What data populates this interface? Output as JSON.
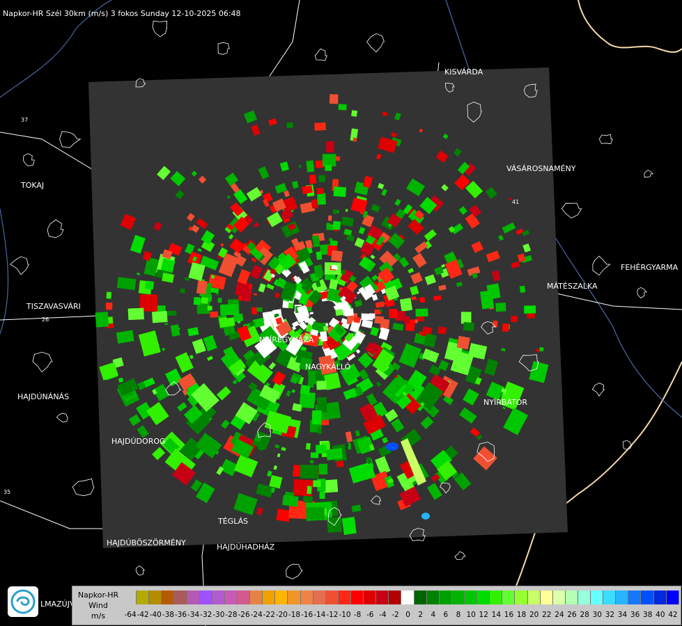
{
  "header": {
    "title": "Napkor-HR Szél 30km (m/s) 3 fokos Sunday 12-10-2025 06:48"
  },
  "map": {
    "background": "#000000",
    "radar_area_color": "#333333",
    "boundary_color": "#f5d9a8",
    "river_color": "#4a6aa8",
    "road_color": "#ffffff",
    "cities": [
      {
        "id": "kisvarda",
        "name": "KISVÁRDA"
      },
      {
        "id": "tokaj",
        "name": "TOKAJ"
      },
      {
        "id": "vasarosnameny",
        "name": "VÁSÁROSNAMÉNY"
      },
      {
        "id": "fehergyarmat",
        "name": "FEHÉRGYARMA"
      },
      {
        "id": "mateszalka",
        "name": "MÁTÉSZALKA"
      },
      {
        "id": "tiszavasvari",
        "name": "TISZAVASVÁRI"
      },
      {
        "id": "nyiregyhaza",
        "name": "NYÍREGYHÁZA"
      },
      {
        "id": "nagykallo",
        "name": "NAGYKÁLLÓ"
      },
      {
        "id": "hajdunanas",
        "name": "HAJDÚNÁNÁS"
      },
      {
        "id": "nyirbator",
        "name": "NYÍRBÁTOR"
      },
      {
        "id": "hajdudorog",
        "name": "HAJDÚDOROG"
      },
      {
        "id": "teglas",
        "name": "TÉGLÁS"
      },
      {
        "id": "hajduboszormeny",
        "name": "HAJDÚBÖSZÖRMÉNY"
      },
      {
        "id": "hajduhadhaz",
        "name": "HAJDÚHADHÁZ"
      }
    ],
    "road_numbers": [
      "37",
      "26",
      "41",
      "35"
    ],
    "partial_label": "LMAZÚJVÁR"
  },
  "legend": {
    "line1": "Napkor-HR",
    "line2": "Wind",
    "line3": "m/s",
    "colors": [
      "#c8c8c8",
      "#b4aa00",
      "#b48c00",
      "#b45a00",
      "#aa5a5a",
      "#b45ab4",
      "#a050ff",
      "#b45ad2",
      "#c85ab4",
      "#d25a8c",
      "#e68246",
      "#f0a000",
      "#ffb400",
      "#f09628",
      "#f08246",
      "#e66e50",
      "#f05032",
      "#ff2814",
      "#ff0000",
      "#dc0000",
      "#c80014",
      "#b40000",
      "#ffffff",
      "#006400",
      "#008200",
      "#00a000",
      "#00b400",
      "#00c800",
      "#00dc00",
      "#32f000",
      "#64ff32",
      "#96ff32",
      "#c8ff64",
      "#ffff96",
      "#dcffaa",
      "#b4ffb4",
      "#96ffdc",
      "#64ffff",
      "#3cdcff",
      "#28b4ff",
      "#1478ff",
      "#0050ff",
      "#0028dc",
      "#0000ff"
    ],
    "ticks": [
      "-64",
      "-42",
      "-40",
      "-38",
      "-36",
      "-34",
      "-32",
      "-30",
      "-28",
      "-26",
      "-24",
      "-22",
      "-20",
      "-18",
      "-16",
      "-14",
      "-12",
      "-10",
      "-8",
      "-6",
      "-4",
      "-2",
      "0",
      "2",
      "4",
      "6",
      "8",
      "10",
      "12",
      "14",
      "16",
      "18",
      "20",
      "22",
      "24",
      "26",
      "28",
      "30",
      "32",
      "34",
      "36",
      "38",
      "40",
      "42"
    ]
  }
}
